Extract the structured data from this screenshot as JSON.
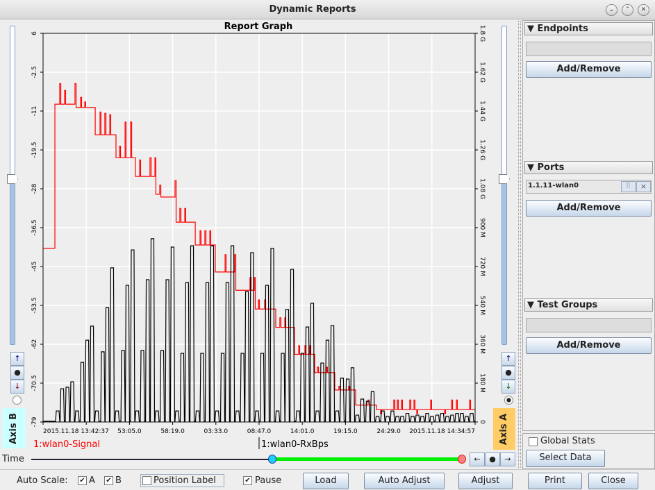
{
  "window": {
    "title": "Dynamic Reports",
    "controls": [
      "minimize-icon",
      "maximize-icon",
      "close-icon"
    ]
  },
  "graph": {
    "title": "Report Graph",
    "axis_b_label": "Axis B",
    "axis_a_label": "Axis A",
    "time_label": "Time",
    "legend": {
      "signal": "1:wlan0-Signal",
      "rxbps": "1:wlan0-RxBps"
    },
    "colors": {
      "signal": "#ff0000",
      "rxbps": "#000000",
      "axis_b_bg": "#ccffff",
      "axis_a_bg": "#ffcc66",
      "plot_bg": "#eeeeee",
      "grid": "#ffffff",
      "time_range": "#00ee00"
    },
    "slider_left_level": 0.52,
    "slider_right_level": 0.52,
    "time_range_start_fraction": 0.56,
    "time_range_end_fraction": 1.0,
    "selected_axis": "A"
  },
  "chart_data": {
    "type": "line",
    "title": "Report Graph",
    "xlim": [
      "13:42:37",
      "14:34:57"
    ],
    "x_ticks": [
      "13:42:37",
      "13:47:51",
      "13:53:05",
      "13:58:19",
      "14:03:33",
      "14:08:47",
      "14:14:01",
      "14:19:15",
      "14:24:29",
      "14:29:43",
      "14:34:57"
    ],
    "x_tick_labels": [
      {
        "at": "13:42:37",
        "text": "2015.11.18 13:42:37"
      },
      {
        "at": "13:53:05",
        "text": "53:05.0"
      },
      {
        "at": "13:58:19",
        "text": "58:19.0"
      },
      {
        "at": "14:03:33",
        "text": "03:33.0"
      },
      {
        "at": "14:08:47",
        "text": "08:47.0"
      },
      {
        "at": "14:14:01",
        "text": "14:01.0"
      },
      {
        "at": "14:19:15",
        "text": "19:15.0"
      },
      {
        "at": "14:24:29",
        "text": "24:29.0"
      },
      {
        "at": "14:34:57",
        "text": "2015.11.18 14:34:57"
      }
    ],
    "left_axis": {
      "range": [
        -79,
        6
      ],
      "ticks": [
        "6",
        "-2.5",
        "-11",
        "-19.5",
        "-28",
        "-36.5",
        "-45",
        "-53.5",
        "-62",
        "-70.5",
        "-79"
      ]
    },
    "right_axis": {
      "range": [
        0,
        1800
      ],
      "unit": "M",
      "ticks": [
        "1.8 G",
        "1.62 G",
        "1.44 G",
        "1.26 G",
        "1.08 G",
        "900 M",
        "720 M",
        "540 M",
        "360 M",
        "180 M",
        "0"
      ]
    },
    "grid": true,
    "series": [
      {
        "name": "1:wlan0-Signal",
        "axis": "left",
        "color": "#ff0000",
        "style": "step",
        "points": [
          [
            "13:42:37",
            -41
          ],
          [
            "13:44:03",
            -9.5
          ],
          [
            "13:44:38",
            -5
          ],
          [
            "13:44:46",
            -9.5
          ],
          [
            "13:45:13",
            -6.5
          ],
          [
            "13:45:21",
            -9.5
          ],
          [
            "13:46:29",
            -5
          ],
          [
            "13:46:37",
            -10.2
          ],
          [
            "13:47:10",
            -8
          ],
          [
            "13:47:17",
            -10.2
          ],
          [
            "13:47:40",
            -9
          ],
          [
            "13:47:47",
            -10.2
          ],
          [
            "13:48:56",
            -16.2
          ],
          [
            "13:49:31",
            -11.2
          ],
          [
            "13:49:38",
            -16.2
          ],
          [
            "13:50:06",
            -11.5
          ],
          [
            "13:50:14",
            -16.2
          ],
          [
            "13:50:42",
            -11.8
          ],
          [
            "13:50:49",
            -16.2
          ],
          [
            "13:51:27",
            -21.2
          ],
          [
            "13:51:52",
            -18.7
          ],
          [
            "13:52:00",
            -21.2
          ],
          [
            "13:52:33",
            -13.4
          ],
          [
            "13:52:40",
            -21.2
          ],
          [
            "13:53:13",
            -13.4
          ],
          [
            "13:53:21",
            -21.2
          ],
          [
            "13:53:48",
            -25.3
          ],
          [
            "13:54:19",
            -21.7
          ],
          [
            "13:54:26",
            -25.3
          ],
          [
            "13:55:34",
            -21.2
          ],
          [
            "13:55:42",
            -25.3
          ],
          [
            "13:56:10",
            -21.2
          ],
          [
            "13:56:17",
            -29.2
          ],
          [
            "13:56:45",
            -27.2
          ],
          [
            "13:56:53",
            -29.8
          ],
          [
            "13:58:36",
            -26.2
          ],
          [
            "13:58:44",
            -35.3
          ],
          [
            "13:59:11",
            -32.3
          ],
          [
            "13:59:19",
            -35.3
          ],
          [
            "13:59:47",
            -32.3
          ],
          [
            "13:59:54",
            -35.3
          ],
          [
            "14:01:03",
            -40.3
          ],
          [
            "14:01:38",
            -37.2
          ],
          [
            "14:01:45",
            -40.3
          ],
          [
            "14:02:13",
            -37.2
          ],
          [
            "14:02:21",
            -40.3
          ],
          [
            "14:02:49",
            -37.2
          ],
          [
            "14:02:56",
            -40.3
          ],
          [
            "14:03:29",
            -46.2
          ],
          [
            "14:04:40",
            -42.4
          ],
          [
            "14:04:47",
            -46.2
          ],
          [
            "14:05:50",
            -42.4
          ],
          [
            "14:05:58",
            -50.2
          ],
          [
            "14:07:41",
            -47.4
          ],
          [
            "14:07:49",
            -50.2
          ],
          [
            "14:08:12",
            -47.4
          ],
          [
            "14:08:19",
            -54.3
          ],
          [
            "14:08:42",
            -52.3
          ],
          [
            "14:08:49",
            -54.3
          ],
          [
            "14:09:27",
            -52.3
          ],
          [
            "14:09:35",
            -54.3
          ],
          [
            "14:10:48",
            -58.3
          ],
          [
            "14:11:18",
            -56.2
          ],
          [
            "14:11:26",
            -58.3
          ],
          [
            "14:11:54",
            -56.2
          ],
          [
            "14:12:01",
            -58.3
          ],
          [
            "14:13:04",
            -64.2
          ],
          [
            "14:13:35",
            -62.3
          ],
          [
            "14:13:42",
            -64.2
          ],
          [
            "14:14:20",
            -62.3
          ],
          [
            "14:14:28",
            -64.2
          ],
          [
            "14:14:55",
            -62.3
          ],
          [
            "14:15:03",
            -64.2
          ],
          [
            "14:15:31",
            -68.2
          ],
          [
            "14:15:51",
            -67
          ],
          [
            "14:15:59",
            -68.2
          ],
          [
            "14:16:57",
            -67
          ],
          [
            "14:17:04",
            -68.2
          ],
          [
            "14:17:57",
            -72
          ],
          [
            "14:18:27",
            -71.2
          ],
          [
            "14:18:35",
            -72
          ],
          [
            "14:19:38",
            -71.2
          ],
          [
            "14:19:46",
            -72
          ],
          [
            "14:20:29",
            -75.3
          ],
          [
            "14:21:59",
            -74.2
          ],
          [
            "14:22:07",
            -75.3
          ],
          [
            "14:23:00",
            -76.3
          ],
          [
            "14:23:30",
            -77.2
          ],
          [
            "14:23:38",
            -76.3
          ],
          [
            "14:25:06",
            -74.2
          ],
          [
            "14:25:14",
            -76.3
          ],
          [
            "14:25:32",
            -74.2
          ],
          [
            "14:25:39",
            -76.3
          ],
          [
            "14:26:02",
            -74.2
          ],
          [
            "14:26:09",
            -76.3
          ],
          [
            "14:27:02",
            -74.2
          ],
          [
            "14:27:10",
            -76.3
          ],
          [
            "14:27:33",
            -74.2
          ],
          [
            "14:27:40",
            -76.3
          ],
          [
            "14:27:53",
            -77.2
          ],
          [
            "14:28:00",
            -76.3
          ],
          [
            "14:29:34",
            -74.2
          ],
          [
            "14:29:41",
            -76.3
          ],
          [
            "14:31:15",
            -77.2
          ],
          [
            "14:31:22",
            -76.3
          ],
          [
            "14:32:05",
            -74.2
          ],
          [
            "14:32:13",
            -76.3
          ],
          [
            "14:32:41",
            -74.2
          ],
          [
            "14:32:48",
            -76.3
          ],
          [
            "14:34:17",
            -74.2
          ],
          [
            "14:34:24",
            -76.3
          ],
          [
            "14:34:57",
            -76.3
          ]
        ]
      },
      {
        "name": "1:wlan0-RxBps",
        "axis": "right",
        "color": "#000000",
        "style": "bursts",
        "unit": "M",
        "points": [
          [
            "13:44:23",
            51
          ],
          [
            "13:44:56",
            154
          ],
          [
            "13:45:34",
            161
          ],
          [
            "13:46:09",
            186
          ],
          [
            "13:46:44",
            51
          ],
          [
            "13:47:22",
            276
          ],
          [
            "13:47:58",
            379
          ],
          [
            "13:48:33",
            444
          ],
          [
            "13:49:08",
            51
          ],
          [
            "13:49:51",
            325
          ],
          [
            "13:50:24",
            530
          ],
          [
            "13:50:59",
            714
          ],
          [
            "13:51:35",
            51
          ],
          [
            "13:52:18",
            331
          ],
          [
            "13:52:50",
            633
          ],
          [
            "13:53:28",
            797
          ],
          [
            "13:54:01",
            51
          ],
          [
            "13:54:39",
            331
          ],
          [
            "13:55:17",
            659
          ],
          [
            "13:55:52",
            849
          ],
          [
            "13:56:25",
            51
          ],
          [
            "13:57:03",
            331
          ],
          [
            "13:57:41",
            659
          ],
          [
            "13:58:18",
            810
          ],
          [
            "13:58:51",
            51
          ],
          [
            "13:59:29",
            318
          ],
          [
            "14:00:04",
            646
          ],
          [
            "14:00:40",
            816
          ],
          [
            "14:01:20",
            51
          ],
          [
            "14:01:53",
            318
          ],
          [
            "14:02:31",
            646
          ],
          [
            "14:03:06",
            816
          ],
          [
            "14:03:42",
            51
          ],
          [
            "14:04:22",
            318
          ],
          [
            "14:04:57",
            646
          ],
          [
            "14:05:33",
            816
          ],
          [
            "14:06:10",
            51
          ],
          [
            "14:06:46",
            318
          ],
          [
            "14:07:19",
            604
          ],
          [
            "14:07:56",
            784
          ],
          [
            "14:08:32",
            51
          ],
          [
            "14:09:10",
            318
          ],
          [
            "14:09:45",
            633
          ],
          [
            "14:10:23",
            804
          ],
          [
            "14:11:01",
            51
          ],
          [
            "14:11:39",
            318
          ],
          [
            "14:12:11",
            521
          ],
          [
            "14:12:47",
            707
          ],
          [
            "14:13:30",
            51
          ],
          [
            "14:14:02",
            318
          ],
          [
            "14:14:38",
            440
          ],
          [
            "14:15:13",
            550
          ],
          [
            "14:15:51",
            51
          ],
          [
            "14:16:26",
            273
          ],
          [
            "14:17:04",
            379
          ],
          [
            "14:17:40",
            447
          ],
          [
            "14:18:15",
            51
          ],
          [
            "14:18:50",
            203
          ],
          [
            "14:19:31",
            199
          ],
          [
            "14:20:06",
            251
          ],
          [
            "14:20:41",
            32
          ],
          [
            "14:21:17",
            106
          ],
          [
            "14:21:57",
            96
          ],
          [
            "14:22:32",
            141
          ],
          [
            "14:23:08",
            26
          ],
          [
            "14:23:46",
            51
          ],
          [
            "14:24:21",
            26
          ],
          [
            "14:24:56",
            51
          ],
          [
            "14:25:32",
            26
          ],
          [
            "14:26:07",
            26
          ],
          [
            "14:26:45",
            40
          ],
          [
            "14:27:23",
            26
          ],
          [
            "14:27:58",
            32
          ],
          [
            "14:28:33",
            26
          ],
          [
            "14:29:09",
            40
          ],
          [
            "14:29:44",
            26
          ],
          [
            "14:30:22",
            32
          ],
          [
            "14:30:57",
            40
          ],
          [
            "14:31:35",
            26
          ],
          [
            "14:32:10",
            32
          ],
          [
            "14:32:46",
            40
          ],
          [
            "14:33:21",
            40
          ],
          [
            "14:33:56",
            26
          ],
          [
            "14:34:32",
            40
          ]
        ]
      }
    ]
  },
  "right_panel": {
    "endpoints": {
      "header": "▼ Endpoints",
      "field": "",
      "button": "Add/Remove"
    },
    "ports": {
      "header": "▼ Ports",
      "items": [
        {
          "label": "1.1.11-wlan0",
          "pause": "||",
          "remove": "×"
        }
      ],
      "button": "Add/Remove"
    },
    "test_groups": {
      "header": "▼ Test Groups",
      "field": "",
      "button": "Add/Remove"
    },
    "global_stats": {
      "label": "Global Stats",
      "checked": false
    },
    "select_data": "Select Data"
  },
  "bottom_bar": {
    "auto_scale_label": "Auto Scale:",
    "auto_scale_a": {
      "label": "A",
      "checked": true
    },
    "auto_scale_b": {
      "label": "B",
      "checked": true
    },
    "position_label": {
      "label": "Position Label",
      "checked": false
    },
    "pause": {
      "label": "Pause",
      "checked": true
    },
    "buttons": {
      "load": "Load",
      "auto_adjust": "Auto Adjust",
      "adjust": "Adjust",
      "print": "Print",
      "close": "Close"
    }
  },
  "nav": {
    "left": "←",
    "center": "●",
    "right": "→",
    "up": "↑",
    "down": "↓"
  }
}
